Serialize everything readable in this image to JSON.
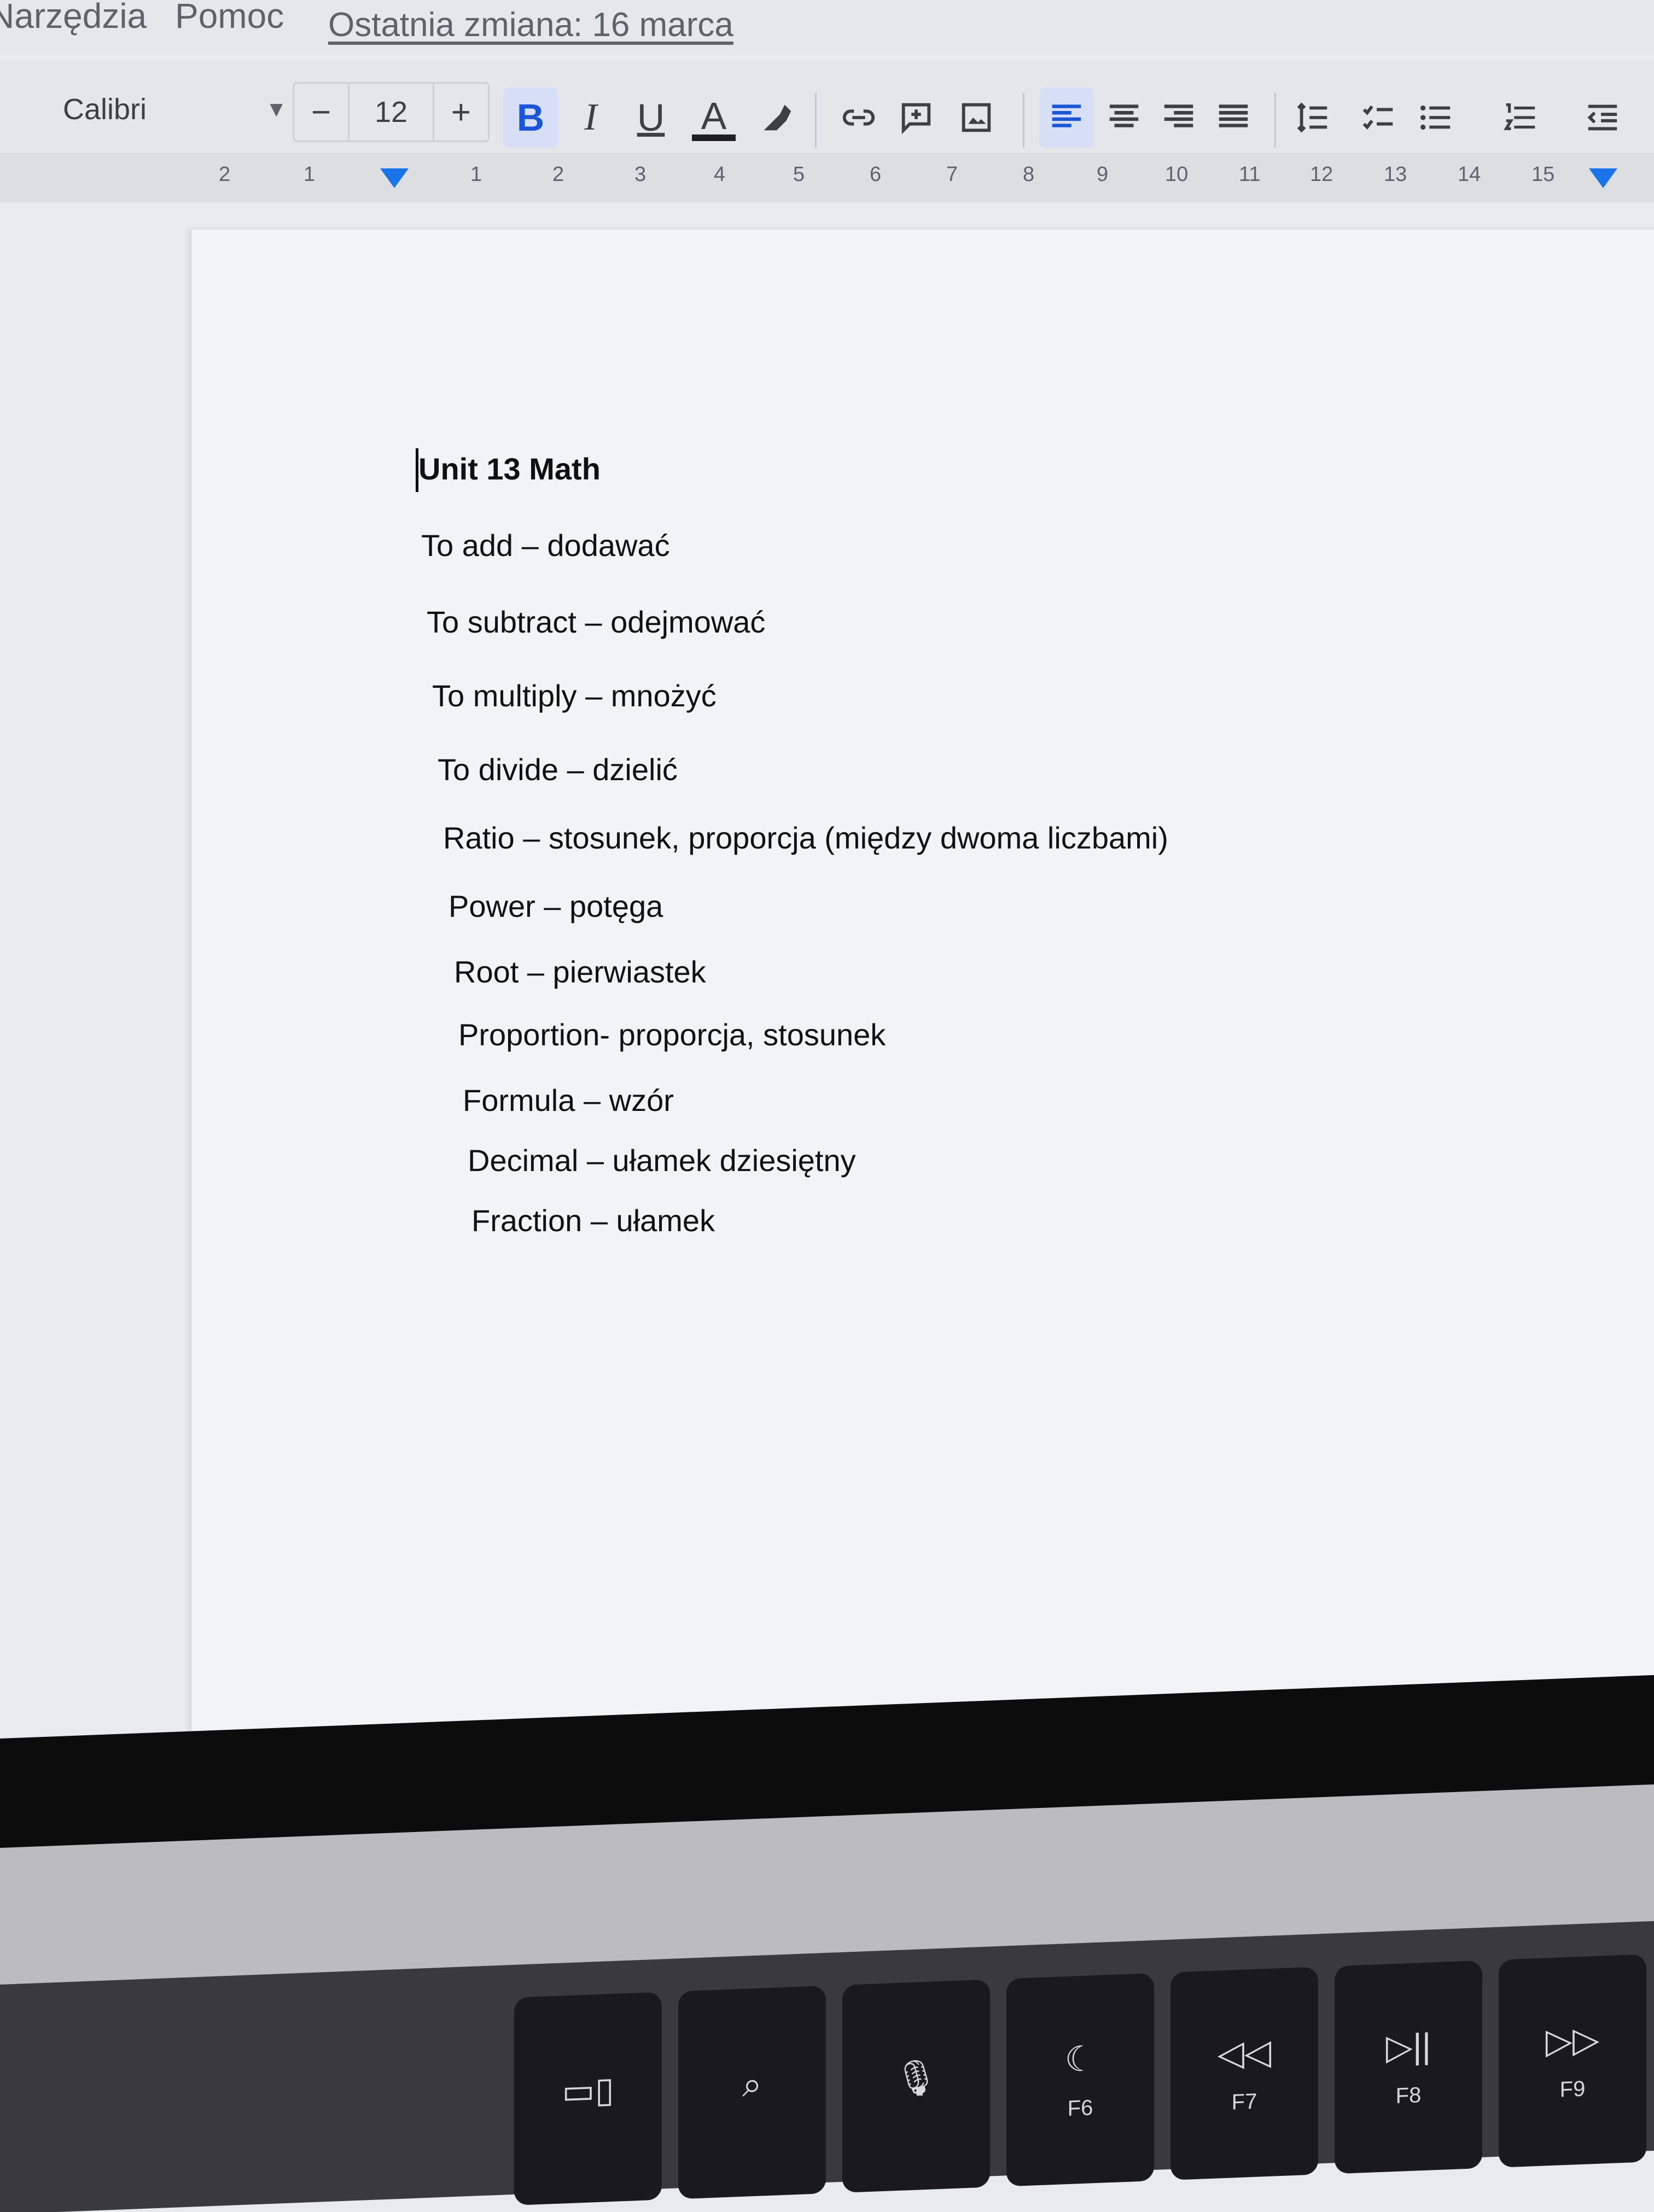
{
  "menu": {
    "tools": "Narzędzia",
    "help": "Pomoc",
    "last_edit": "Ostatnia zmiana: 16 marca"
  },
  "toolbar": {
    "font": "Calibri",
    "font_size": "12",
    "decrease": "−",
    "increase": "+",
    "bold": "B",
    "italic": "I",
    "underline": "U",
    "text_color": "A",
    "icons": [
      "highlighter-icon",
      "link-icon",
      "comment-icon",
      "image-icon",
      "align-left-icon",
      "align-center-icon",
      "align-right-icon",
      "justify-icon",
      "line-spacing-icon",
      "checklist-icon",
      "bulleted-list-icon",
      "numbered-list-icon",
      "decrease-indent-icon"
    ],
    "accent_color": "#1a73e8"
  },
  "ruler": {
    "numbers": [
      "2",
      "1",
      "1",
      "2",
      "3",
      "4",
      "5",
      "6",
      "7",
      "8",
      "9",
      "10",
      "11",
      "12",
      "13",
      "14",
      "15"
    ]
  },
  "document": {
    "title": "Unit 13  Math",
    "lines": [
      "To add – dodawać",
      "To subtract – odejmować",
      "To multiply – mnożyć",
      "To divide – dzielić",
      "Ratio – stosunek, proporcja (między dwoma liczbami)",
      "Power – potęga",
      "Root – pierwiastek",
      "Proportion- proporcja, stosunek",
      "Formula – wzór",
      "Decimal – ułamek dziesiętny",
      "Fraction – ułamek"
    ]
  },
  "keyboard": {
    "keys": [
      "",
      "",
      "",
      "F6",
      "F7",
      "F8",
      "F9"
    ],
    "icons": [
      "multitask-icon",
      "search-icon",
      "microphone-icon",
      "moon-icon",
      "rewind-icon",
      "play-pause-icon",
      "fast-forward-icon"
    ]
  }
}
